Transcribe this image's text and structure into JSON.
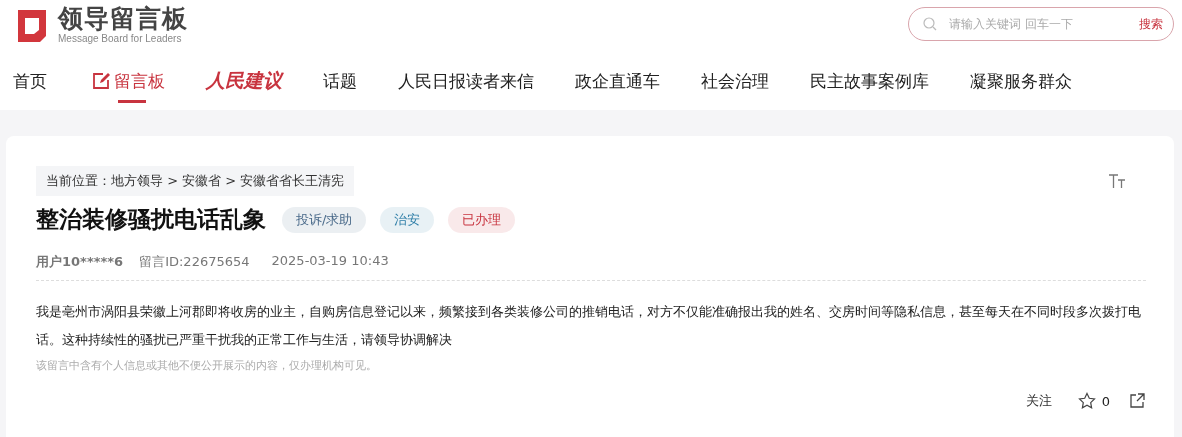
{
  "logo": {
    "title": "领导留言板",
    "subtitle": "Message Board for Leaders"
  },
  "search": {
    "placeholder": "请输入关键词 回车一下",
    "button": "搜索"
  },
  "nav": [
    {
      "label": "首页",
      "kind": "plain",
      "selected": false
    },
    {
      "label": "留言板",
      "kind": "board",
      "selected": true
    },
    {
      "label": "人民建议",
      "kind": "brand",
      "selected": false
    },
    {
      "label": "话题",
      "kind": "plain",
      "selected": false
    },
    {
      "label": "人民日报读者来信",
      "kind": "plain",
      "selected": false
    },
    {
      "label": "政企直通车",
      "kind": "plain",
      "selected": false
    },
    {
      "label": "社会治理",
      "kind": "plain",
      "selected": false
    },
    {
      "label": "民主故事案例库",
      "kind": "plain",
      "selected": false
    },
    {
      "label": "凝聚服务群众",
      "kind": "plain",
      "selected": false
    }
  ],
  "breadcrumb": "当前位置：地方领导 > 安徽省 > 安徽省省长王清宪",
  "message": {
    "title": "整治装修骚扰电话乱象",
    "tags": [
      {
        "label": "投诉/求助",
        "color": "#4a6a8a"
      },
      {
        "label": "治安",
        "color": "#2f7fa8"
      },
      {
        "label": "已办理",
        "color": "#c8343f"
      }
    ],
    "user": "用户10*****6",
    "id": "留言ID:22675654",
    "time": "2025-03-19 10:43",
    "body": "我是亳州市涡阳县荣徽上河郡即将收房的业主，自购房信息登记以来，频繁接到各类装修公司的推销电话，对方不仅能准确报出我的姓名、交房时间等隐私信息，甚至每天在不同时段多次拨打电话。这种持续性的骚扰已严重干扰我的正常工作与生活，请领导协调解决",
    "notice": "该留言中含有个人信息或其他不便公开展示的内容，仅办理机构可见。",
    "follow": "关注",
    "likes": "0"
  }
}
